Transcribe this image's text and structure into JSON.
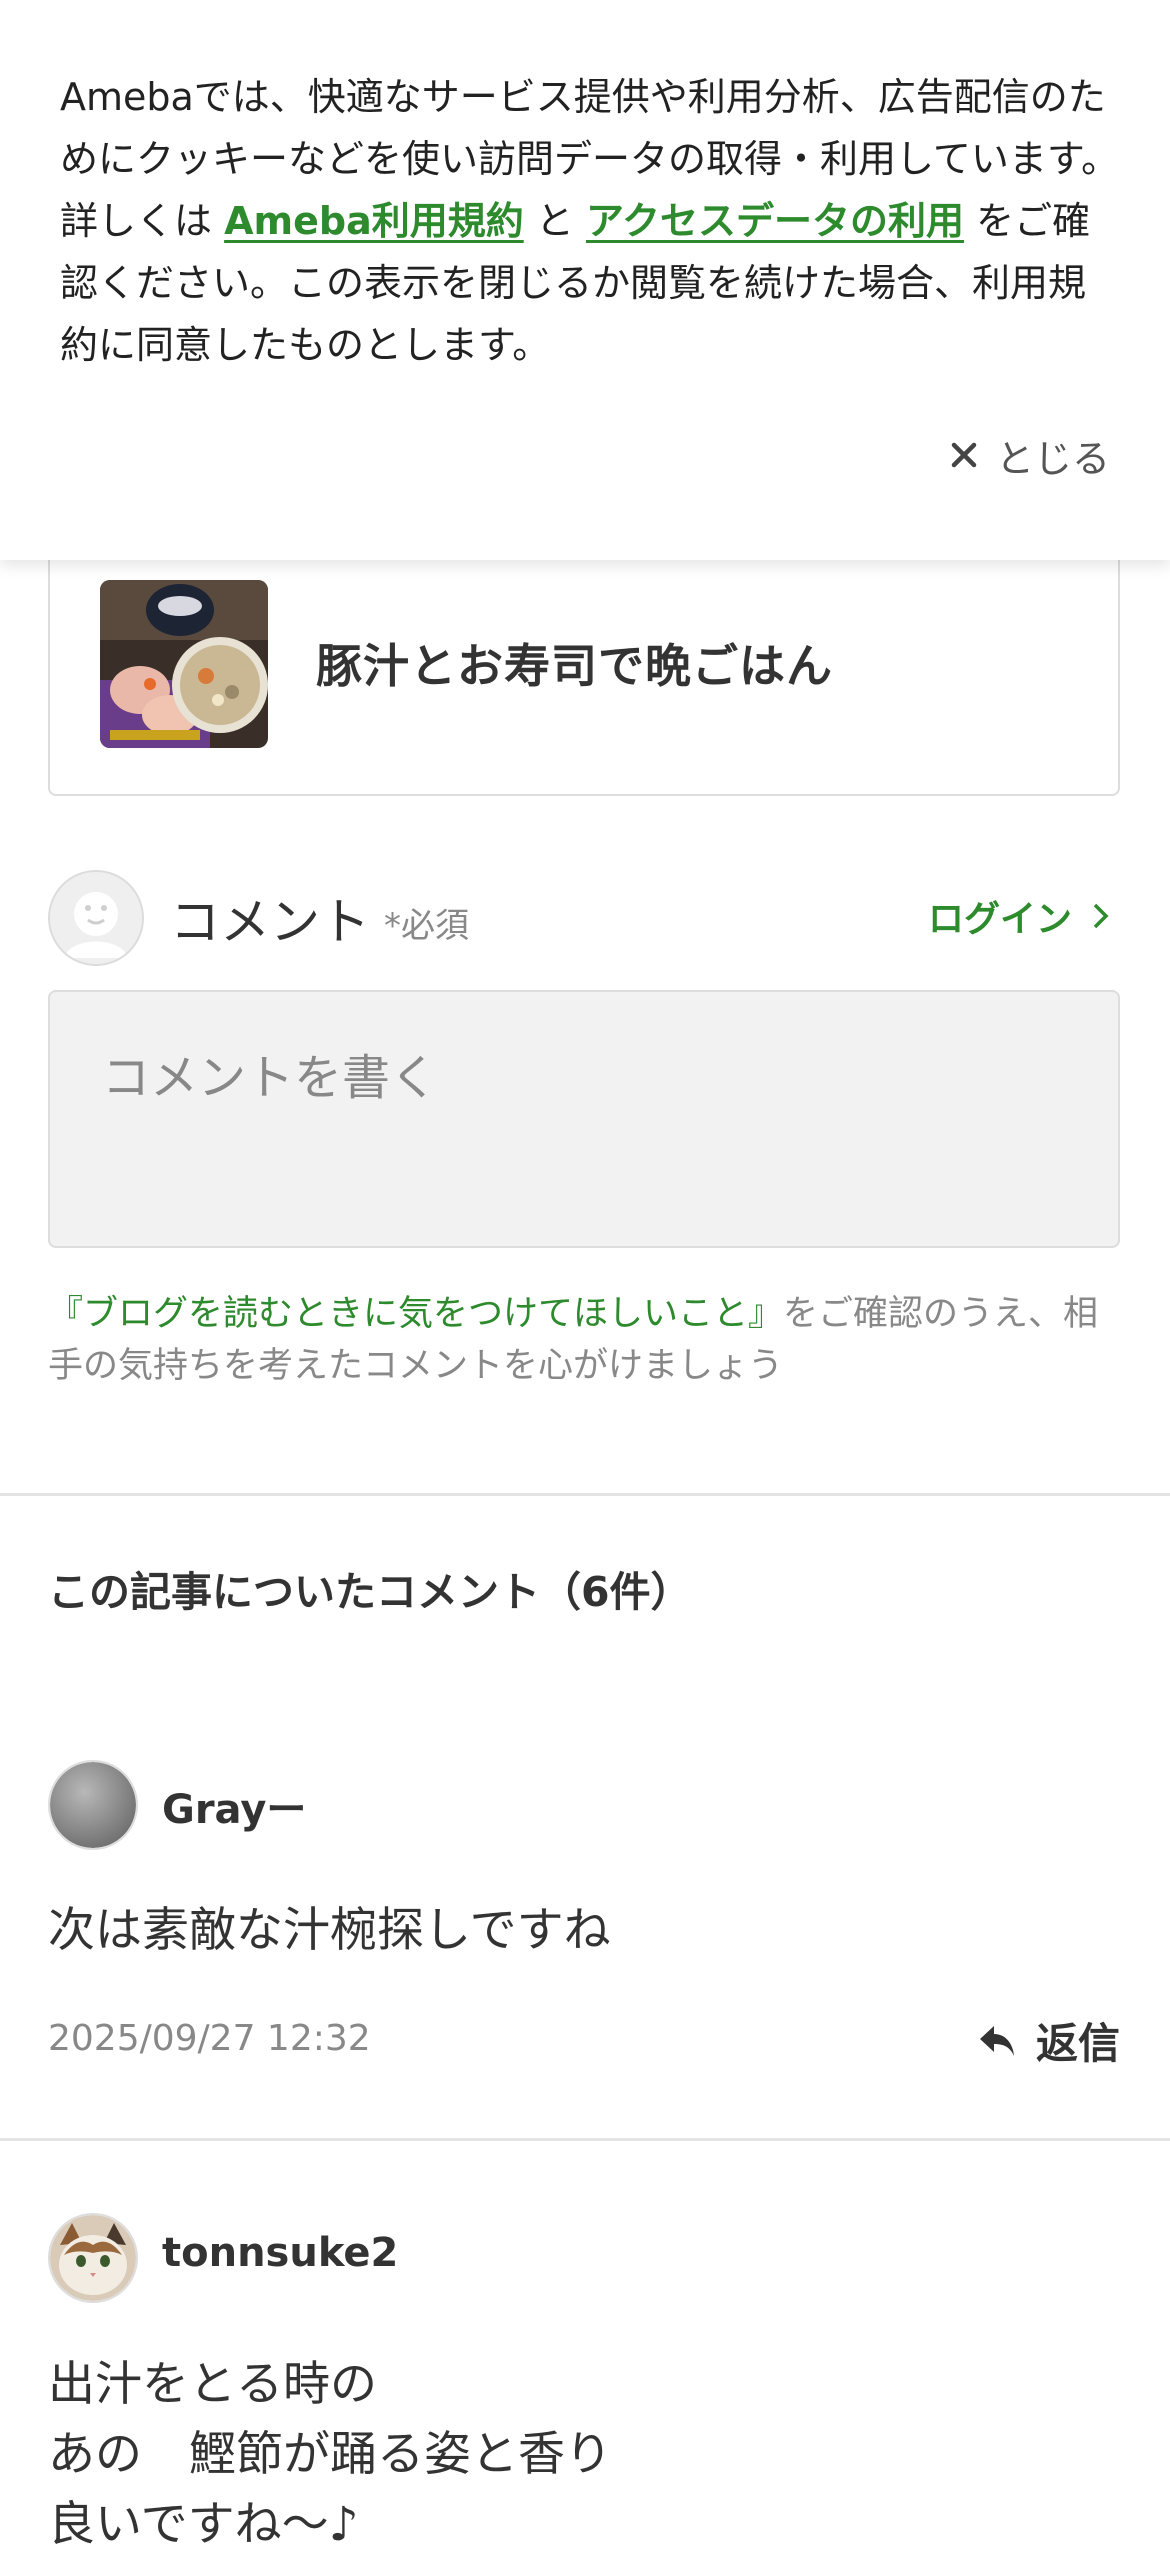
{
  "cookie_banner": {
    "text_part1": "Amebaでは、快適なサービス提供や利用分析、広告配信のためにクッキーなどを使い訪問データの取得・利用しています。詳しくは",
    "link1": "Ameba利用規約",
    "conjunction": "と",
    "link2": "アクセスデータの利用",
    "text_part2": "をご確認ください。この表示を閉じるか閲覧を続けた場合、利用規約に同意したものとします。",
    "close_label": "とじる",
    "close_icon": "close-icon"
  },
  "related_article": {
    "title": "豚汁とお寿司で晩ごはん"
  },
  "comment_form": {
    "label": "コメント",
    "required": "*必須",
    "login_label": "ログイン",
    "placeholder": "コメントを書く",
    "guide_link": "『ブログを読むときに気をつけてほしいこと』",
    "guide_text": "をご確認のうえ、相手の気持ちを考えたコメントを心がけましょう"
  },
  "comments_section": {
    "title": "この記事についたコメント（6件）",
    "reply_label": "返信",
    "comments": [
      {
        "author": "Grayー",
        "body": "次は素敵な汁椀探しですね",
        "timestamp": "2025/09/27 12:32"
      },
      {
        "author": "tonnsuke2",
        "body_lines": [
          "出汁をとる時の",
          "あの　鰹節が踊る姿と香り",
          "良いですね～♪"
        ]
      }
    ]
  },
  "colors": {
    "accent_green": "#2d8a2d",
    "muted_text": "#888888",
    "body_text": "#333333"
  }
}
